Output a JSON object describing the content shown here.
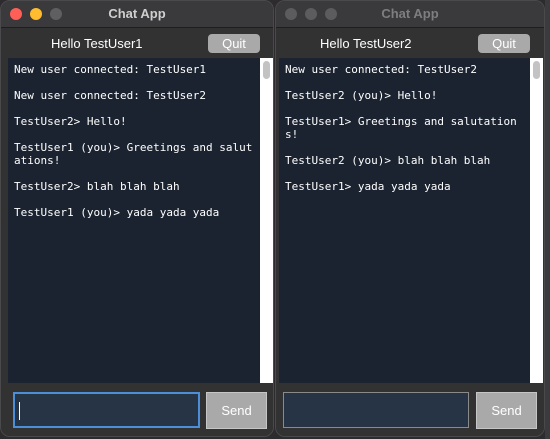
{
  "windows": [
    {
      "title": "Chat App",
      "greeting": "Hello TestUser1",
      "quit_label": "Quit",
      "send_label": "Send",
      "input_value": "",
      "active": true,
      "messages": [
        "New user connected: TestUser1",
        "New user connected: TestUser2",
        "TestUser2> Hello!",
        "TestUser1 (you)> Greetings and salutations!",
        "TestUser2> blah blah blah",
        "TestUser1 (you)> yada yada yada"
      ]
    },
    {
      "title": "Chat App",
      "greeting": "Hello TestUser2",
      "quit_label": "Quit",
      "send_label": "Send",
      "input_value": "",
      "active": false,
      "messages": [
        "New user connected: TestUser2",
        "TestUser2 (you)> Hello!",
        "TestUser1> Greetings and salutations!",
        "TestUser2 (you)> blah blah blah",
        "TestUser1> yada yada yada"
      ]
    }
  ],
  "colors": {
    "chat_background": "#1b2330",
    "input_background": "#263445",
    "button_gray": "#a9a9a9",
    "focus_ring": "#4c8fd6",
    "close_red": "#ff5f57",
    "minimize_yellow": "#febc2e"
  },
  "icons": {
    "close": "close-icon",
    "minimize": "minimize-icon",
    "zoom": "zoom-icon"
  }
}
